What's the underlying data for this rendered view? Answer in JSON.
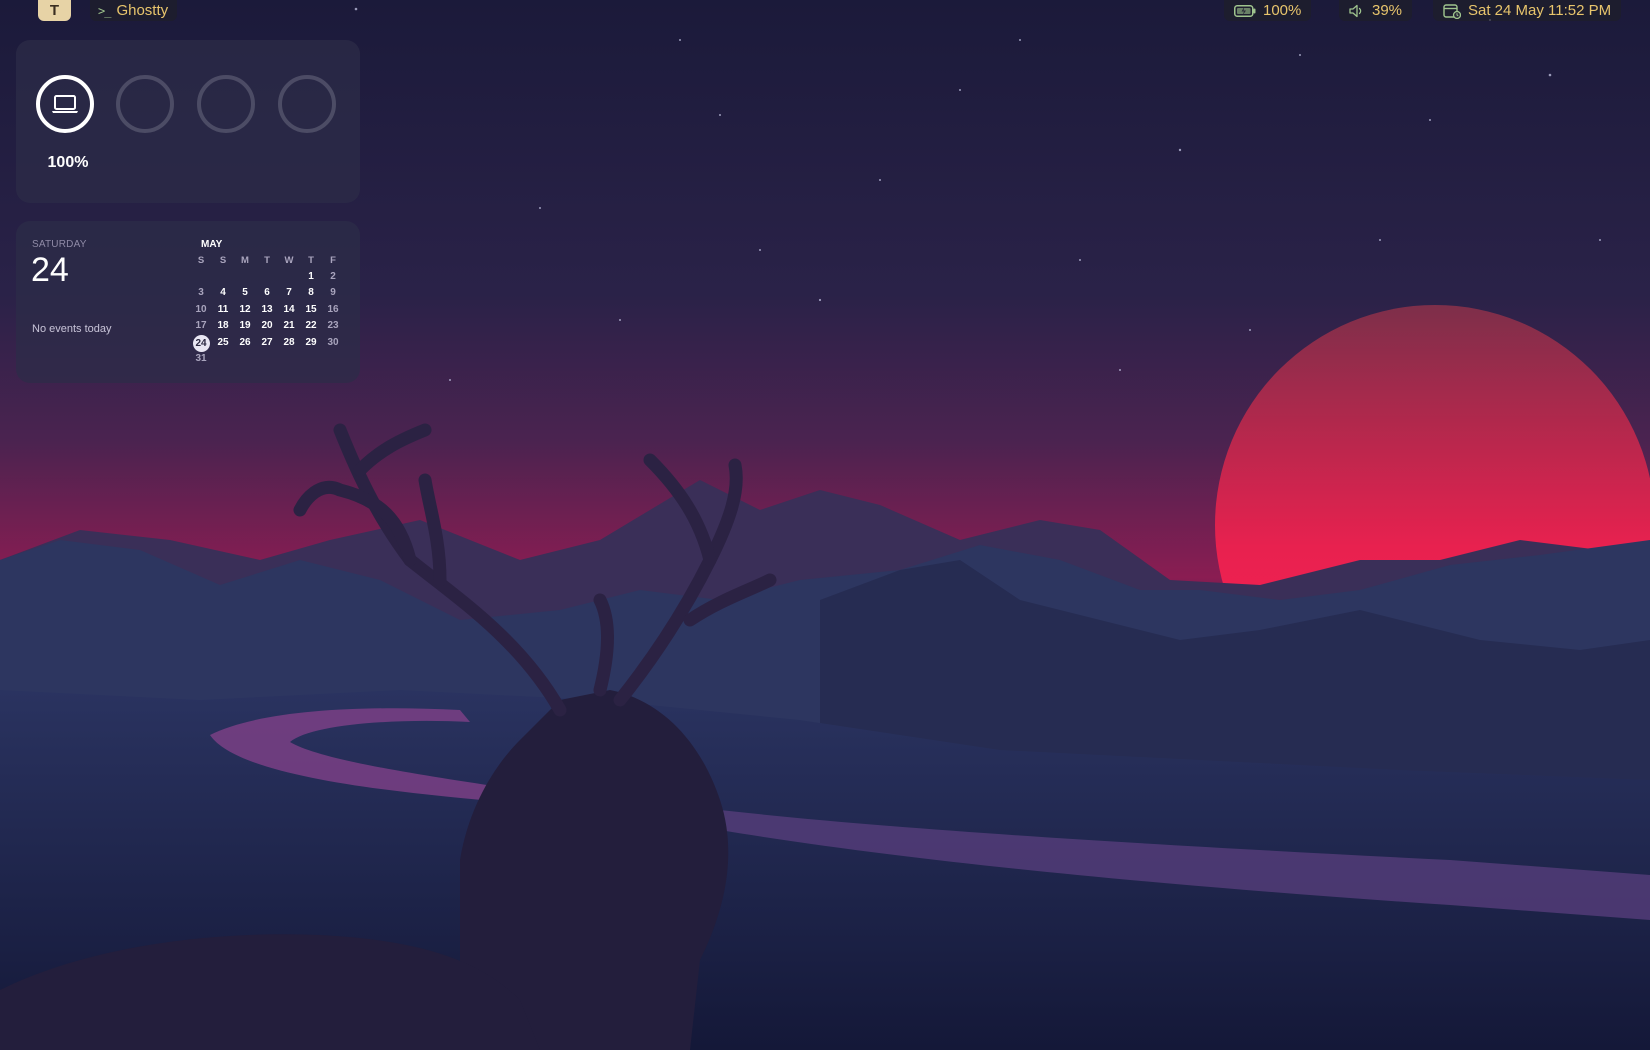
{
  "topbar": {
    "workspace_label": "T",
    "app_name": "Ghostty",
    "app_icon": "terminal-icon",
    "battery": {
      "icon": "battery-charging-icon",
      "text": "100%"
    },
    "volume": {
      "icon": "speaker-icon",
      "text": "39%"
    },
    "clock": {
      "icon": "calendar-clock-icon",
      "text": "Sat 24 May 11:52 PM"
    },
    "text_color": "#e8c56c"
  },
  "battery_widget": {
    "devices": [
      {
        "icon": "laptop-icon",
        "active": true,
        "level": "100%"
      },
      {
        "icon": "",
        "active": false
      },
      {
        "icon": "",
        "active": false
      },
      {
        "icon": "",
        "active": false
      }
    ],
    "percent_label": "100%"
  },
  "calendar_widget": {
    "weekday": "SATURDAY",
    "day_number": "24",
    "events_text": "No events today",
    "month": "MAY",
    "weekday_headers": [
      "S",
      "S",
      "M",
      "T",
      "W",
      "T",
      "F"
    ],
    "days": [
      "",
      "",
      "",
      "",
      "",
      "1",
      "2",
      "3",
      "4",
      "5",
      "6",
      "7",
      "8",
      "9",
      "10",
      "11",
      "12",
      "13",
      "14",
      "15",
      "16",
      "17",
      "18",
      "19",
      "20",
      "21",
      "22",
      "23",
      "24",
      "25",
      "26",
      "27",
      "28",
      "29",
      "30",
      "31",
      "",
      "",
      "",
      "",
      "",
      ""
    ],
    "today": "24"
  },
  "wallpaper": {
    "description_colors": {
      "sky_top": "#1c1a3a",
      "sky_horizon": "#8a1d52",
      "sun": "#e8214f"
    }
  }
}
